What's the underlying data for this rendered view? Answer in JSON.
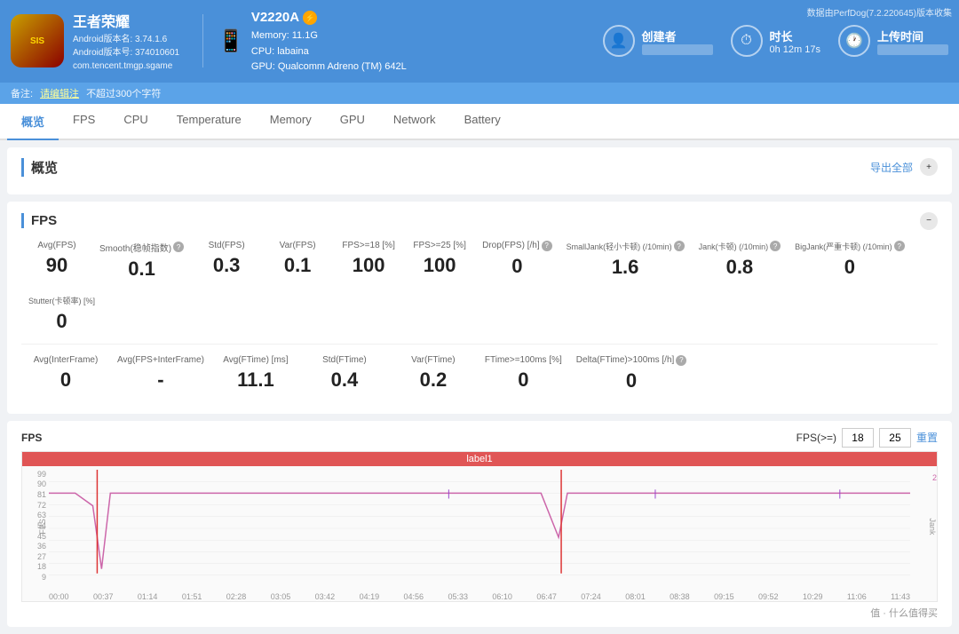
{
  "header": {
    "top_note": "数据由PerfDog(7.2.220645)版本收集",
    "game": {
      "icon_text": "王者",
      "title": "王者荣耀",
      "version1": "Android版本名: 3.74.1.6",
      "version2": "Android版本号: 374010601",
      "package": "com.tencent.tmgp.sgame"
    },
    "device": {
      "name": "V2220A",
      "memory": "Memory: 11.1G",
      "cpu": "CPU: labaina",
      "gpu": "GPU: Qualcomm Adreno (TM) 642L"
    },
    "stats": [
      {
        "icon": "👤",
        "label": "创建者",
        "value": ""
      },
      {
        "icon": "⏱",
        "label": "时长",
        "value": "0h 12m 17s"
      },
      {
        "icon": "🕐",
        "label": "上传时间",
        "value": ""
      }
    ]
  },
  "note_bar": {
    "text": "备注:",
    "link_text": "请编辑注",
    "limit_text": "不超过300个字符"
  },
  "tabs": [
    {
      "label": "概览",
      "active": true
    },
    {
      "label": "FPS",
      "active": false
    },
    {
      "label": "CPU",
      "active": false
    },
    {
      "label": "Temperature",
      "active": false
    },
    {
      "label": "Memory",
      "active": false
    },
    {
      "label": "GPU",
      "active": false
    },
    {
      "label": "Network",
      "active": false
    },
    {
      "label": "Battery",
      "active": false
    }
  ],
  "overview_section": {
    "title": "概览",
    "export_label": "导出全部"
  },
  "fps_section": {
    "title": "FPS",
    "expand_icon": "−",
    "stats_row1": [
      {
        "label": "Avg(FPS)",
        "value": "90",
        "has_help": false
      },
      {
        "label": "Smooth(稳帧指数)",
        "value": "0.1",
        "has_help": true
      },
      {
        "label": "Std(FPS)",
        "value": "0.3",
        "has_help": false
      },
      {
        "label": "Var(FPS)",
        "value": "0.1",
        "has_help": false
      },
      {
        "label": "FPS>=18 [%]",
        "value": "100",
        "has_help": false
      },
      {
        "label": "FPS>=25 [%]",
        "value": "100",
        "has_help": false
      },
      {
        "label": "Drop(FPS) [/h]",
        "value": "0",
        "has_help": true
      },
      {
        "label": "SmallJank(轻小卡顿) (/10min)",
        "value": "1.6",
        "has_help": true
      },
      {
        "label": "Jank(卡顿) (/10min)",
        "value": "0.8",
        "has_help": true
      },
      {
        "label": "BigJank(严重卡顿) (/10min)",
        "value": "0",
        "has_help": true
      },
      {
        "label": "Stutter(卡顿率) [%]",
        "value": "0",
        "has_help": false
      }
    ],
    "stats_row2": [
      {
        "label": "Avg(InterFrame)",
        "value": "0",
        "has_help": false
      },
      {
        "label": "Avg(FPS+InterFrame)",
        "value": "-",
        "has_help": false
      },
      {
        "label": "Avg(FTime) [ms]",
        "value": "11.1",
        "has_help": false
      },
      {
        "label": "Std(FTime)",
        "value": "0.4",
        "has_help": false
      },
      {
        "label": "Var(FTime)",
        "value": "0.2",
        "has_help": false
      },
      {
        "label": "FTime>=100ms [%]",
        "value": "0",
        "has_help": false
      },
      {
        "label": "Delta(FTime)>100ms [/h]",
        "value": "0",
        "has_help": true
      }
    ]
  },
  "chart": {
    "title": "FPS",
    "label1": "label1",
    "fps_gte_label": "FPS(>=)",
    "fps_val1": "18",
    "fps_val2": "25",
    "reset_label": "重置",
    "y_labels": [
      "99",
      "90",
      "81",
      "72",
      "63",
      "54",
      "45",
      "36",
      "27",
      "18",
      "9",
      ""
    ],
    "x_labels": [
      "00:00",
      "00:37",
      "01:14",
      "01:51",
      "02:28",
      "03:05",
      "03:42",
      "04:19",
      "04:56",
      "05:33",
      "06:10",
      "06:47",
      "07:24",
      "08:01",
      "08:38",
      "09:15",
      "09:52",
      "10:29",
      "11:06",
      "11:43"
    ],
    "right_label": "2",
    "jank_label": "Jank"
  }
}
